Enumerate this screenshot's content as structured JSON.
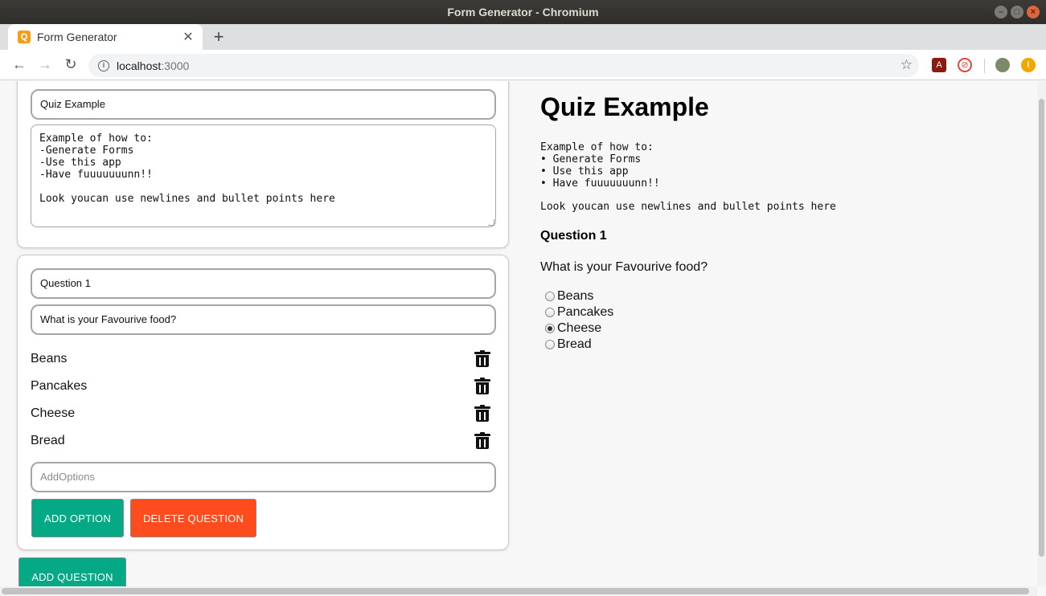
{
  "window": {
    "title": "Form Generator - Chromium"
  },
  "browser": {
    "tab_title": "Form Generator",
    "url_host": "localhost",
    "url_port": ":3000"
  },
  "editor": {
    "form_title_value": "Quiz Example",
    "form_description_value": "Example of how to:\n-Generate Forms\n-Use this app\n-Have fuuuuuuunn!!\n\nLook youcan use newlines and bullet points here",
    "question": {
      "title_value": "Question 1",
      "text_value": "What is your Favourive food?",
      "options": [
        "Beans",
        "Pancakes",
        "Cheese",
        "Bread"
      ],
      "add_option_placeholder": "AddOptions",
      "add_option_label": "Add Option",
      "delete_question_label": "Delete Question"
    },
    "add_question_label": "Add Question"
  },
  "preview": {
    "title": "Quiz Example",
    "description_intro": "Example of how to:",
    "bullets": [
      "Generate Forms",
      "Use this app",
      "Have fuuuuuuunn!!"
    ],
    "note": "Look youcan use newlines and bullet points here",
    "question_title": "Question 1",
    "question_text": "What is your Favourive food?",
    "options": [
      "Beans",
      "Pancakes",
      "Cheese",
      "Bread"
    ],
    "selected_option": "Cheese"
  },
  "colors": {
    "primary_button": "#05a986",
    "danger_button": "#ff4c1f"
  }
}
